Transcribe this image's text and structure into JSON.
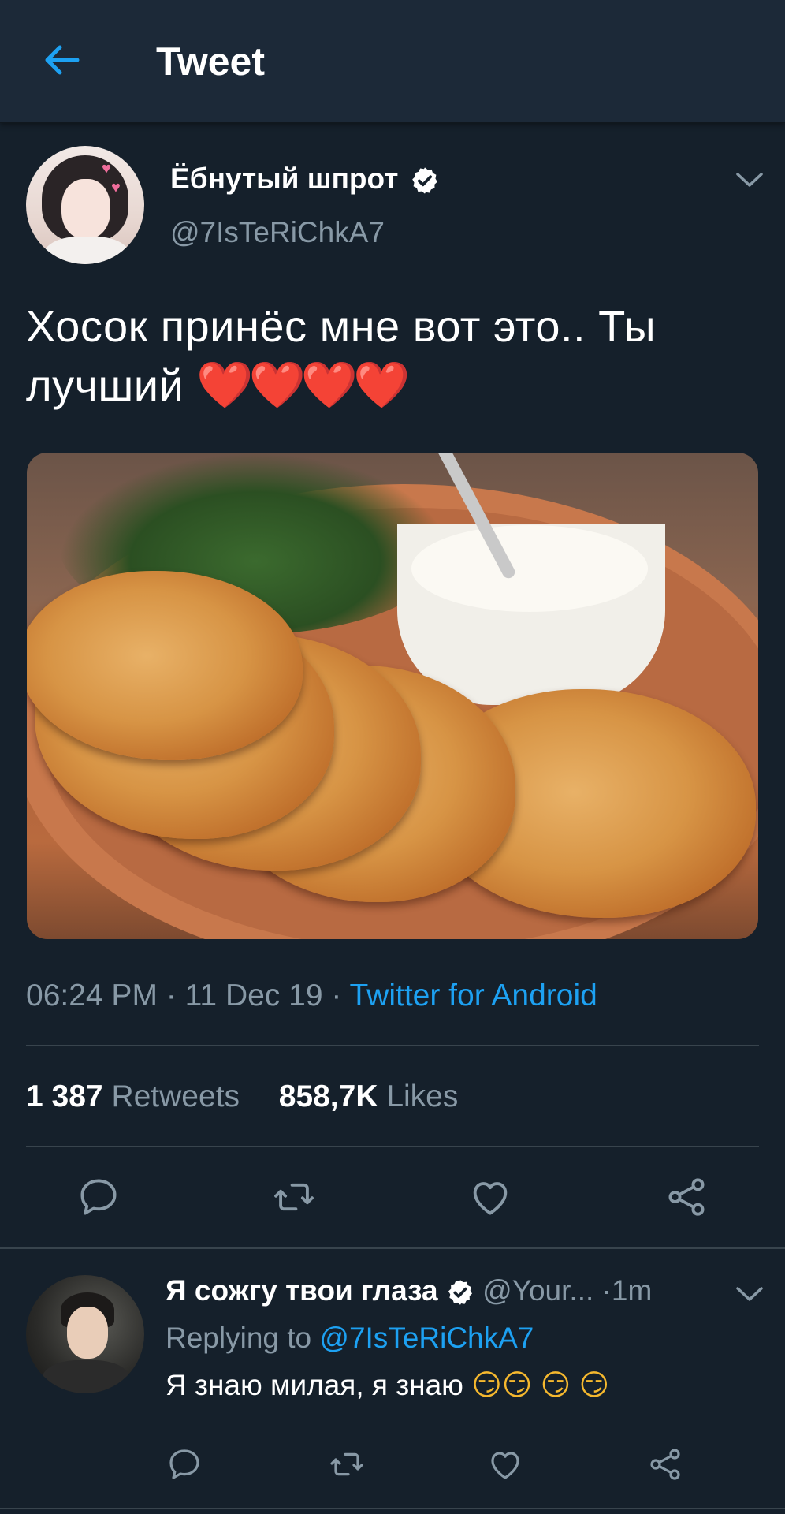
{
  "header": {
    "title": "Tweet",
    "back_icon": "arrow-left-icon"
  },
  "tweet": {
    "author_name": "Ёбнутый шпрот",
    "author_handle": "@7IsTeRiChkA7",
    "verified": true,
    "text": "Хосок принёс мне вот это.. Ты лучший",
    "emoji": "❤️❤️❤️❤️",
    "media_alt": "potato pancakes with sour cream",
    "time": "06:24 PM",
    "date": "11 Dec 19",
    "separator": "·",
    "source": "Twitter for Android",
    "retweets_count": "1 387",
    "retweets_label": "Retweets",
    "likes_count": "858,7K",
    "likes_label": "Likes"
  },
  "reply": {
    "author_name": "Я сожгу твои глаза",
    "author_handle": "@Your...",
    "verified": true,
    "time": "1m",
    "separator": "·",
    "replying_prefix": "Replying to",
    "replying_to": "@7IsTeRiChkA7",
    "text": "Я знаю милая, я знаю",
    "emoji": "😏😏 😏 😏"
  },
  "colors": {
    "background": "#15202b",
    "header": "#1c2938",
    "accent": "#1da1f2",
    "muted": "#8899a6",
    "divider": "#38444d",
    "heart": "#e0245e"
  }
}
